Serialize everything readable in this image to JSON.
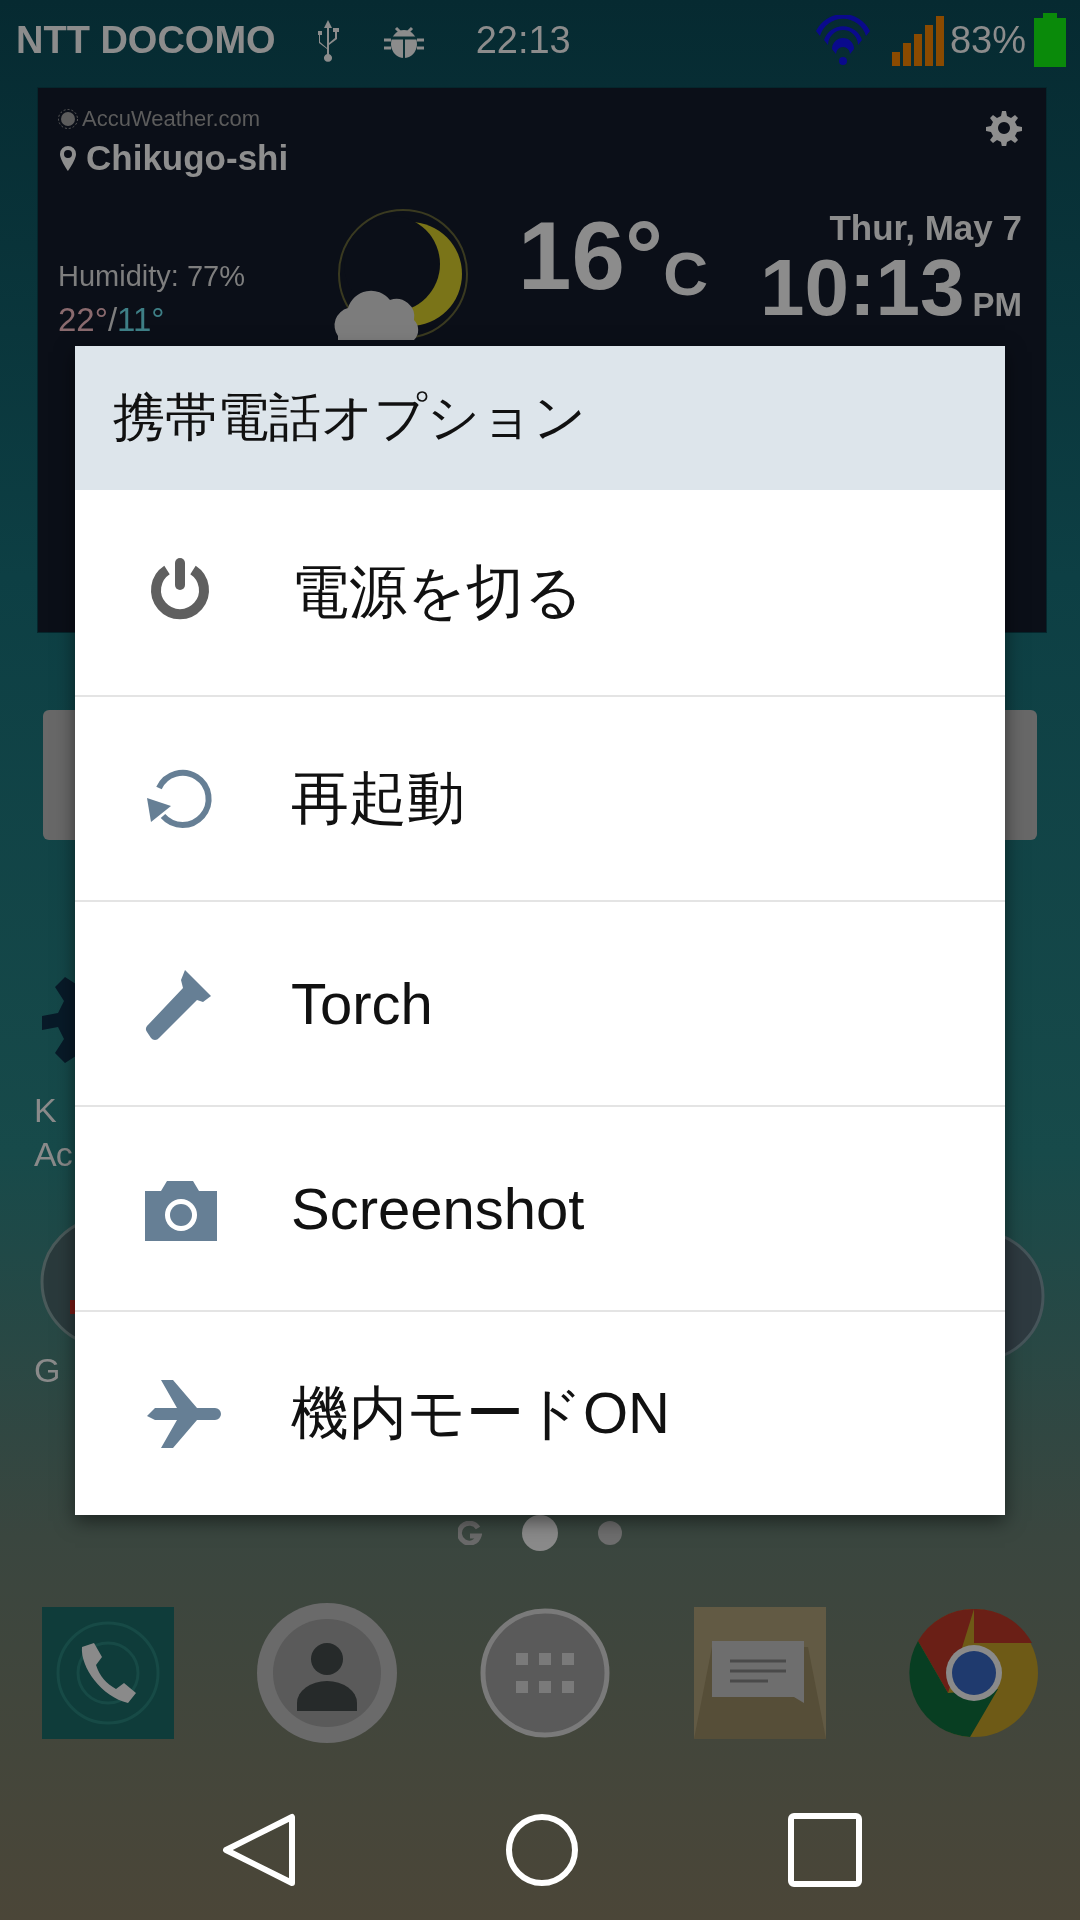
{
  "status_bar": {
    "carrier": "NTT DOCOMO",
    "time": "22:13",
    "battery": "83%"
  },
  "weather_widget": {
    "source": "AccuWeather.com",
    "location": "Chikugo-shi",
    "humidity": "Humidity: 77%",
    "high": "22°",
    "separator": "/",
    "low": "11°",
    "temperature": "16°",
    "unit": "C",
    "date": "Thur, May 7",
    "clock": "10:13",
    "meridiem": "PM"
  },
  "home_labels": [
    "K",
    "Ac",
    "G"
  ],
  "page_indicator": [
    {
      "kind": "google",
      "selected": false
    },
    {
      "kind": "dot",
      "selected": true
    },
    {
      "kind": "dot",
      "selected": false
    }
  ],
  "dock": [
    {
      "kind": "phone"
    },
    {
      "kind": "contacts"
    },
    {
      "kind": "apps"
    },
    {
      "kind": "messages"
    },
    {
      "kind": "browser"
    }
  ],
  "dialog": {
    "title": "携帯電話オプション",
    "options": [
      {
        "kind": "power",
        "label": "電源を切る"
      },
      {
        "kind": "restart",
        "label": "再起動"
      },
      {
        "kind": "torch",
        "label": "Torch"
      },
      {
        "kind": "screenshot",
        "label": "Screenshot"
      },
      {
        "kind": "airplane",
        "label": "機内モードON"
      }
    ]
  }
}
